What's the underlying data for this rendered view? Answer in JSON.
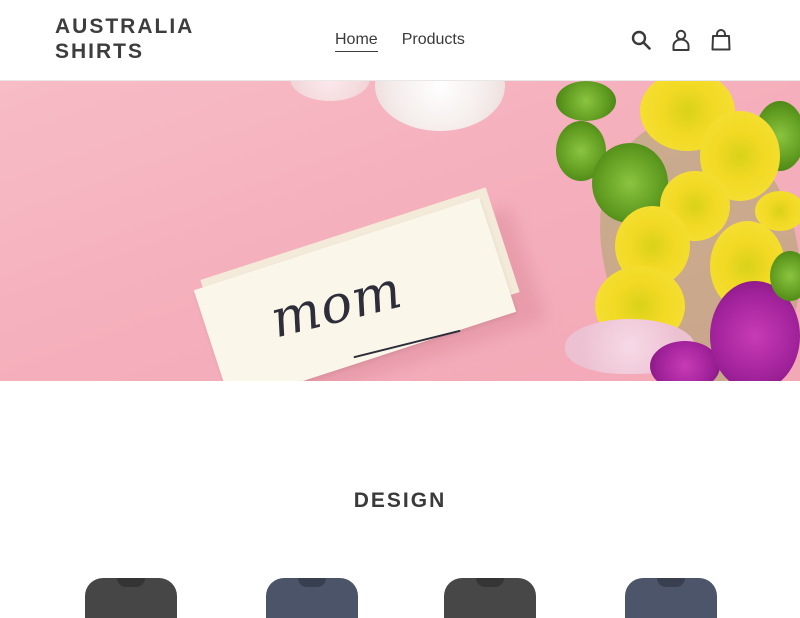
{
  "header": {
    "logo_line1": "AUSTRALIA",
    "logo_line2": "SHIRTS",
    "nav": [
      {
        "label": "Home",
        "active": true
      },
      {
        "label": "Products",
        "active": false
      }
    ],
    "icons": [
      "search-icon",
      "account-icon",
      "cart-icon"
    ]
  },
  "hero": {
    "card_text": "mom"
  },
  "section": {
    "title": "DESIGN",
    "products": [
      {
        "color": "#464646"
      },
      {
        "color": "#4b5468"
      },
      {
        "color": "#474747"
      },
      {
        "color": "#4c556a"
      }
    ]
  },
  "colors": {
    "text": "#3a3a3a",
    "hero_pink": "#f5b0bd"
  }
}
